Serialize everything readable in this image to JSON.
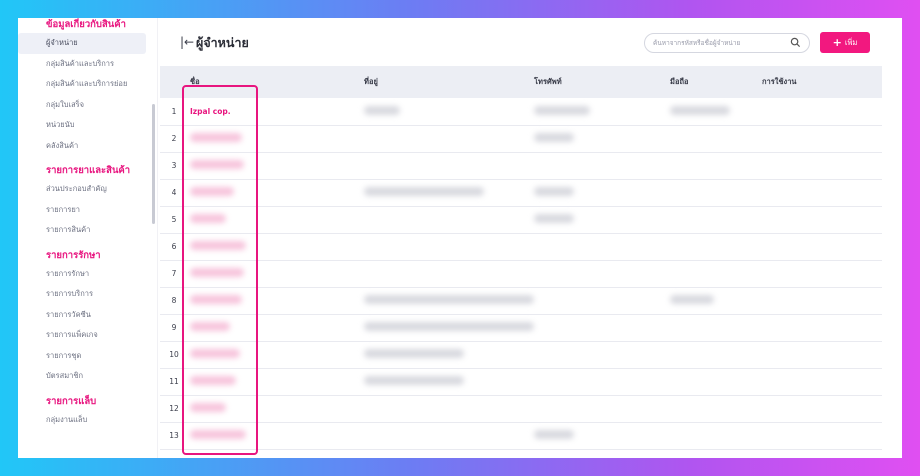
{
  "sidebar": {
    "sections": [
      {
        "title": "ข้อมูลเกี่ยวกับสินค้า",
        "items": [
          {
            "label": "ผู้จำหน่าย",
            "active": true
          },
          {
            "label": "กลุ่มสินค้าและบริการ",
            "active": false
          },
          {
            "label": "กลุ่มสินค้าและบริการย่อย",
            "active": false
          },
          {
            "label": "กลุ่มใบเสร็จ",
            "active": false
          },
          {
            "label": "หน่วยนับ",
            "active": false
          },
          {
            "label": "คลังสินค้า",
            "active": false
          }
        ]
      },
      {
        "title": "รายการยาและสินค้า",
        "items": [
          {
            "label": "ส่วนประกอบสำคัญ",
            "active": false
          },
          {
            "label": "รายการยา",
            "active": false
          },
          {
            "label": "รายการสินค้า",
            "active": false
          }
        ]
      },
      {
        "title": "รายการรักษา",
        "items": [
          {
            "label": "รายการรักษา",
            "active": false
          },
          {
            "label": "รายการบริการ",
            "active": false
          },
          {
            "label": "รายการวัคซีน",
            "active": false
          },
          {
            "label": "รายการแพ็คเกจ",
            "active": false
          },
          {
            "label": "รายการชุด",
            "active": false
          },
          {
            "label": "บัตรสมาชิก",
            "active": false
          }
        ]
      },
      {
        "title": "รายการแล็บ",
        "items": [
          {
            "label": "กลุ่มงานแล็บ",
            "active": false
          }
        ]
      }
    ]
  },
  "header": {
    "title": "ผู้จำหน่าย",
    "search_placeholder": "ค้นหาจากรหัสหรือชื่อผู้จำหน่าย",
    "add_label": "เพิ่ม"
  },
  "table": {
    "columns": [
      "ชื่อ",
      "ที่อยู่",
      "โทรศัพท์",
      "มือถือ",
      "การใช้งาน"
    ],
    "rows": [
      {
        "no": "1",
        "name": "Izpal cop."
      },
      {
        "no": "2",
        "name": ""
      },
      {
        "no": "3",
        "name": ""
      },
      {
        "no": "4",
        "name": ""
      },
      {
        "no": "5",
        "name": ""
      },
      {
        "no": "6",
        "name": ""
      },
      {
        "no": "7",
        "name": ""
      },
      {
        "no": "8",
        "name": ""
      },
      {
        "no": "9",
        "name": ""
      },
      {
        "no": "10",
        "name": ""
      },
      {
        "no": "11",
        "name": ""
      },
      {
        "no": "12",
        "name": ""
      },
      {
        "no": "13",
        "name": ""
      }
    ]
  },
  "colors": {
    "accent": "#e8157f",
    "button": "#f2187f",
    "header_bg": "#eceef4"
  }
}
